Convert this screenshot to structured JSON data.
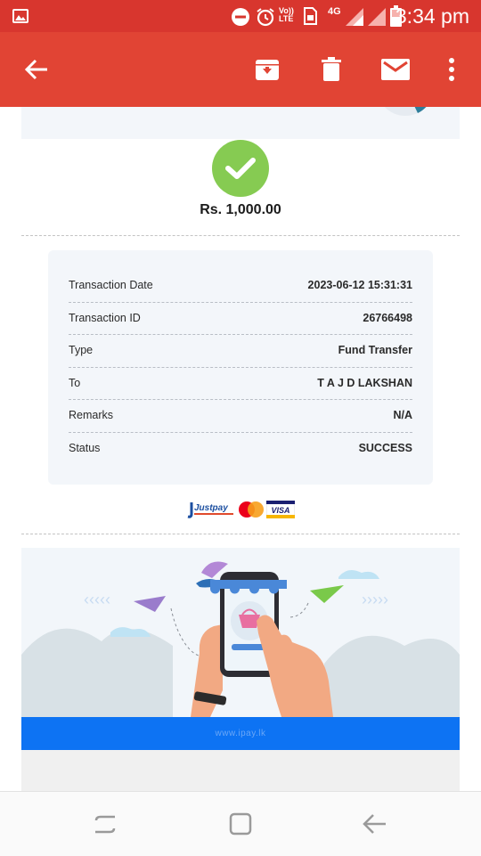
{
  "status_bar": {
    "time": "3:34 pm",
    "network": "4G",
    "volte_label": "Vo)) LTE",
    "icons": [
      "gallery-icon",
      "do-not-disturb-icon",
      "alarm-icon",
      "volte-icon",
      "sim-icon",
      "signal-icon",
      "signal-icon",
      "battery-icon"
    ]
  },
  "app_bar": {
    "icons": [
      "back-arrow-icon",
      "archive-icon",
      "delete-icon",
      "mail-icon",
      "more-vert-icon"
    ]
  },
  "receipt": {
    "amount": "Rs. 1,000.00",
    "rows": [
      {
        "label": "Transaction Date",
        "value": "2023-06-12 15:31:31"
      },
      {
        "label": "Transaction ID",
        "value": "26766498"
      },
      {
        "label": "Type",
        "value": "Fund Transfer"
      },
      {
        "label": "To",
        "value": "T A J D LAKSHAN"
      },
      {
        "label": "Remarks",
        "value": "N/A"
      },
      {
        "label": "Status",
        "value": "SUCCESS"
      }
    ]
  },
  "payment_logos": {
    "justpay": "Justpay",
    "visa": "VISA"
  },
  "footer": {
    "url": "www.ipay.lk"
  },
  "colors": {
    "status_bar": "#d8362e",
    "app_bar": "#e14434",
    "success_green": "#86cb52",
    "footer_blue": "#0d73f3"
  },
  "nav_bar": {
    "icons": [
      "recent-apps-icon",
      "home-icon",
      "back-icon"
    ]
  }
}
